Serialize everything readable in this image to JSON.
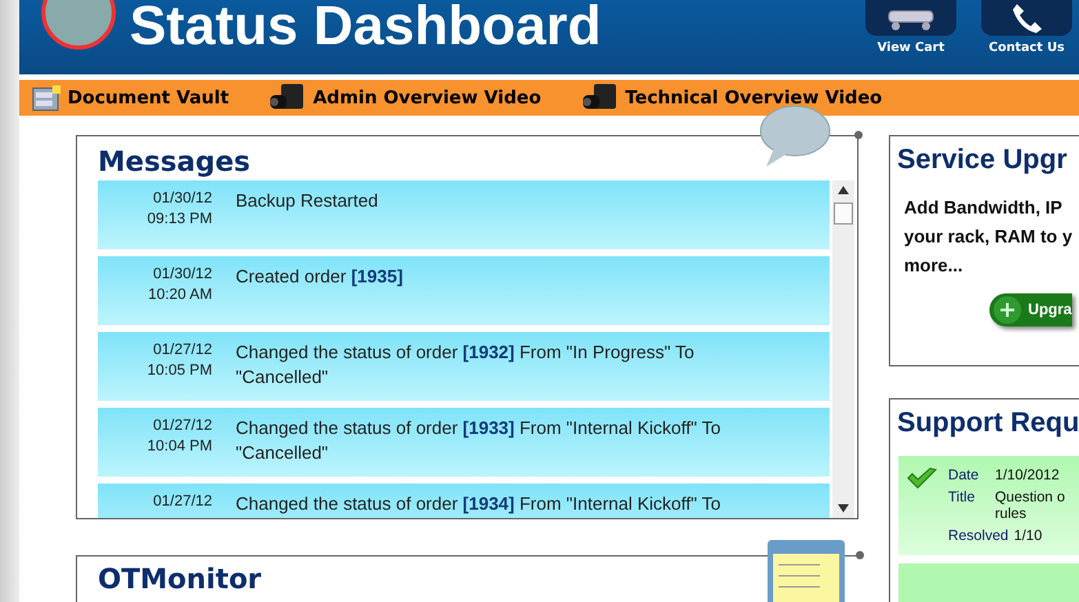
{
  "header": {
    "title": "Status Dashboard",
    "buttons": [
      {
        "label": "View Cart",
        "kind": "cart"
      },
      {
        "label": "Contact Us",
        "kind": "phone"
      }
    ]
  },
  "nav": [
    {
      "label": "Document Vault",
      "kind": "vault"
    },
    {
      "label": "Admin Overview Video",
      "kind": "video"
    },
    {
      "label": "Technical Overview Video",
      "kind": "video"
    }
  ],
  "messages": {
    "title": "Messages",
    "items": [
      {
        "date": "01/30/12",
        "time": "09:13 PM",
        "text": "Backup Restarted"
      },
      {
        "date": "01/30/12",
        "time": "10:20 AM",
        "text": "Created order **[1935]**"
      },
      {
        "date": "01/27/12",
        "time": "10:05 PM",
        "text": "Changed the status of order **[1932]** From \"In Progress\" To \"Cancelled\""
      },
      {
        "date": "01/27/12",
        "time": "10:04 PM",
        "text": "Changed the status of order **[1933]** From \"Internal Kickoff\" To \"Cancelled\""
      },
      {
        "date": "01/27/12",
        "text": "Changed the status of order **[1934]** From \"Internal Kickoff\" To"
      }
    ]
  },
  "otmonitor": {
    "title": "OTMonitor"
  },
  "service": {
    "title": "Service Upgr",
    "lines": [
      "Add Bandwidth, IP",
      "your rack, RAM to y",
      "more..."
    ],
    "button": "Upgra"
  },
  "support": {
    "title": "Support Requ",
    "requests": [
      {
        "fields": [
          {
            "label": "Date",
            "value": "1/10/2012"
          },
          {
            "label": "Title",
            "value": "Question o rules"
          },
          {
            "label": "Resolved",
            "value": "1/10"
          }
        ]
      }
    ]
  }
}
